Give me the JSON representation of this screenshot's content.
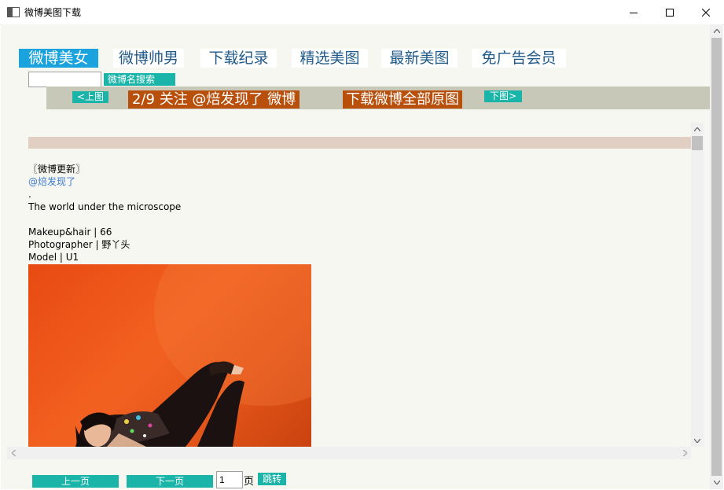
{
  "window": {
    "title": "微博美图下载"
  },
  "tabs": [
    {
      "label": "微博美女",
      "active": true
    },
    {
      "label": "微博帅男",
      "active": false
    },
    {
      "label": "下载纪录",
      "active": false
    },
    {
      "label": "精选美图",
      "active": false
    },
    {
      "label": "最新美图",
      "active": false
    },
    {
      "label": "免广告会员",
      "active": false
    }
  ],
  "search": {
    "value": "",
    "button_label": "微博名搜索"
  },
  "toolbar": {
    "prev_image": "<上图",
    "follow_text": "2/9 关注 @焙发现了 微博",
    "download_all": "下载微博全部原图",
    "next_image": "下图>"
  },
  "post": {
    "lines": [
      {
        "text": "〖微博更新〗",
        "style": "normal"
      },
      {
        "text": "@焙发现了",
        "style": "mention"
      },
      {
        "text": ".",
        "style": "normal"
      },
      {
        "text": "The world under the microscope",
        "style": "normal"
      },
      {
        "text": "",
        "style": "normal"
      },
      {
        "text": "Makeup&hair | 66",
        "style": "normal"
      },
      {
        "text": "Photographer | 野丫头",
        "style": "normal"
      },
      {
        "text": "Model | U1",
        "style": "normal"
      }
    ]
  },
  "pager": {
    "prev_label": "上一页",
    "next_label": "下一页",
    "page_value": "1",
    "page_unit": "页",
    "jump_label": "跳转"
  },
  "colors": {
    "active_tab": "#1aa3dc",
    "teal_button": "#1ab5a8",
    "brown_button": "#b8500c",
    "toolbar_bg": "#c8c8b8"
  }
}
